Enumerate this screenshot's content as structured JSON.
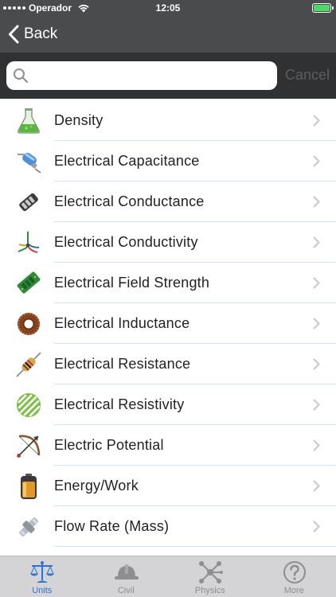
{
  "status_bar": {
    "carrier": "Operador",
    "time": "12:05"
  },
  "nav": {
    "back_label": "Back"
  },
  "search": {
    "placeholder": "",
    "value": "",
    "cancel_label": "Cancel"
  },
  "list": {
    "items": [
      {
        "label": "Density",
        "icon": "flask-icon"
      },
      {
        "label": "Electrical Capacitance",
        "icon": "capacitor-icon"
      },
      {
        "label": "Electrical Conductance",
        "icon": "conductor-icon"
      },
      {
        "label": "Electrical Conductivity",
        "icon": "wires-icon"
      },
      {
        "label": "Electrical Field Strength",
        "icon": "circuit-board-icon"
      },
      {
        "label": "Electrical Inductance",
        "icon": "inductor-coil-icon"
      },
      {
        "label": "Electrical Resistance",
        "icon": "resistor-icon"
      },
      {
        "label": "Electrical Resistivity",
        "icon": "resistivity-icon"
      },
      {
        "label": "Electric Potential",
        "icon": "bow-arrow-icon"
      },
      {
        "label": "Energy/Work",
        "icon": "battery-icon"
      },
      {
        "label": "Flow Rate (Mass)",
        "icon": "pipe-valve-icon"
      }
    ]
  },
  "tabs": [
    {
      "label": "Units",
      "icon": "scales-icon",
      "active": true
    },
    {
      "label": "Civil",
      "icon": "hard-hat-icon",
      "active": false
    },
    {
      "label": "Physics",
      "icon": "molecule-icon",
      "active": false
    },
    {
      "label": "More",
      "icon": "question-icon",
      "active": false
    }
  ],
  "colors": {
    "header": "#4a4b4d",
    "search_bar": "#303133",
    "active_tab": "#2b74d4",
    "inactive_tab": "#8e8e90",
    "separator": "#cfe6ee"
  }
}
